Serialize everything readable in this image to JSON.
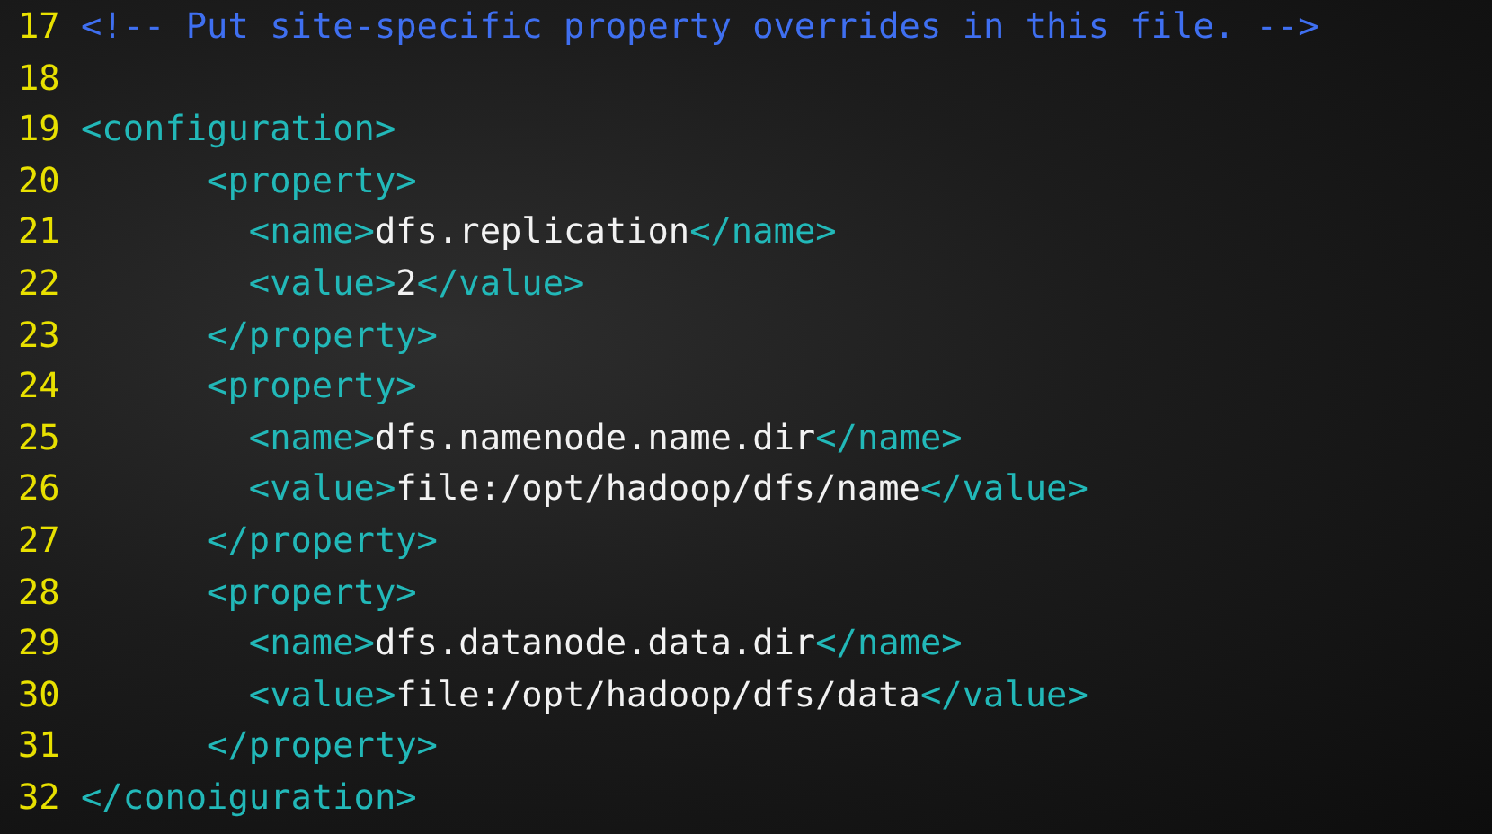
{
  "editor": {
    "lines": [
      {
        "number": "17",
        "segments": [
          {
            "kind": "comment",
            "text": "<!-- Put site-specific property overrides in this file. -->"
          }
        ]
      },
      {
        "number": "18"
      },
      {
        "number": "19",
        "segments": [
          {
            "kind": "tag",
            "text": "<configuration>"
          }
        ]
      },
      {
        "number": "20",
        "segments": [
          {
            "kind": "tag",
            "text": "      <property>"
          }
        ]
      },
      {
        "number": "21",
        "segments": [
          {
            "kind": "tag",
            "text": "        <name>"
          },
          {
            "kind": "text",
            "text": "dfs.replication"
          },
          {
            "kind": "tag",
            "text": "</name>"
          }
        ]
      },
      {
        "number": "22",
        "segments": [
          {
            "kind": "tag",
            "text": "        <value>"
          },
          {
            "kind": "text",
            "text": "2"
          },
          {
            "kind": "tag",
            "text": "</value>"
          }
        ]
      },
      {
        "number": "23",
        "segments": [
          {
            "kind": "tag",
            "text": "      </property>"
          }
        ]
      },
      {
        "number": "24",
        "segments": [
          {
            "kind": "tag",
            "text": "      <property>"
          }
        ]
      },
      {
        "number": "25",
        "segments": [
          {
            "kind": "tag",
            "text": "        <name>"
          },
          {
            "kind": "text",
            "text": "dfs.namenode.name.dir"
          },
          {
            "kind": "tag",
            "text": "</name>"
          }
        ]
      },
      {
        "number": "26",
        "segments": [
          {
            "kind": "tag",
            "text": "        <value>"
          },
          {
            "kind": "text",
            "text": "file:/opt/hadoop/dfs/name"
          },
          {
            "kind": "tag",
            "text": "</value>"
          }
        ]
      },
      {
        "number": "27",
        "segments": [
          {
            "kind": "tag",
            "text": "      </property>"
          }
        ]
      },
      {
        "number": "28",
        "segments": [
          {
            "kind": "tag",
            "text": "      <property>"
          }
        ]
      },
      {
        "number": "29",
        "segments": [
          {
            "kind": "tag",
            "text": "        <name>"
          },
          {
            "kind": "text",
            "text": "dfs.datanode.data.dir"
          },
          {
            "kind": "tag",
            "text": "</name>"
          }
        ]
      },
      {
        "number": "30",
        "segments": [
          {
            "kind": "tag",
            "text": "        <value>"
          },
          {
            "kind": "text",
            "text": "file:/opt/hadoop/dfs/data"
          },
          {
            "kind": "tag",
            "text": "</value>"
          }
        ]
      },
      {
        "number": "31",
        "segments": [
          {
            "kind": "tag",
            "text": "      </property>"
          }
        ]
      },
      {
        "number": "32",
        "segments": [
          {
            "kind": "tag",
            "text": "</conoiguration>"
          }
        ]
      }
    ]
  }
}
